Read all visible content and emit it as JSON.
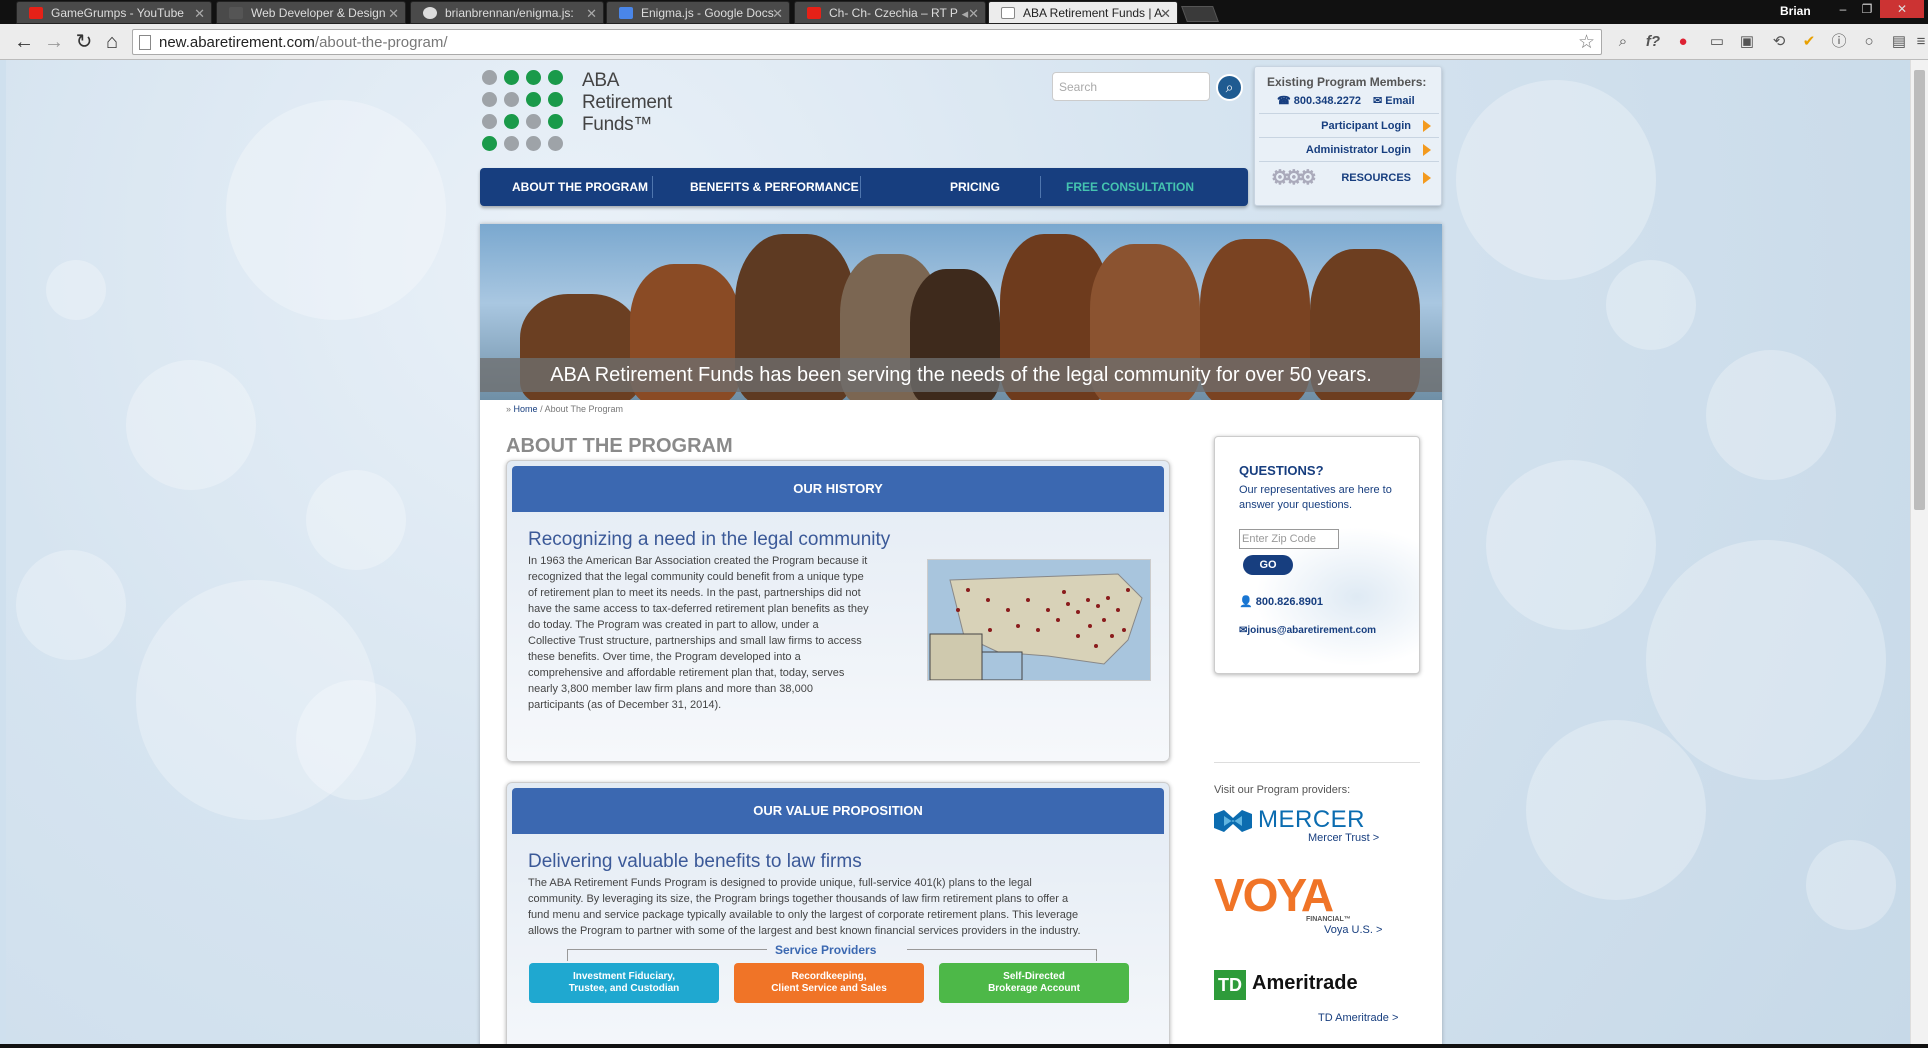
{
  "browser": {
    "tabs": [
      {
        "title": "GameGrumps - YouTube",
        "icon": "youtube-icon",
        "color": "#e62117"
      },
      {
        "title": "Web Developer & Design",
        "icon": "page-icon",
        "color": "#555555"
      },
      {
        "title": "brianbrennan/enigma.js:",
        "icon": "github-icon",
        "color": "#dddddd"
      },
      {
        "title": "Enigma.js - Google Docs",
        "icon": "docs-icon",
        "color": "#4a86e8"
      },
      {
        "title": "Ch- Ch- Czechia – RT P",
        "icon": "youtube-icon",
        "color": "#e62117"
      },
      {
        "title": "ABA Retirement Funds | A",
        "icon": "page-icon",
        "color": "#555555"
      }
    ],
    "user": "Brian",
    "url_domain": "new.abaretirement.com",
    "url_path": "/about-the-program/"
  },
  "site": {
    "logo_line1": "ABA",
    "logo_line2": "Retirement",
    "logo_line3": "Funds™",
    "search_placeholder": "Search",
    "nav": [
      "ABOUT THE PROGRAM",
      "BENEFITS & PERFORMANCE",
      "PRICING",
      "FREE CONSULTATION"
    ],
    "members": {
      "heading": "Existing Program Members:",
      "phone": "800.348.2272",
      "email": "Email",
      "participant_login": "Participant Login",
      "administrator_login": "Administrator Login",
      "resources": "RESOURCES"
    },
    "hero_caption": "ABA Retirement Funds has been serving the needs of the legal community for over 50 years.",
    "breadcrumb": {
      "prefix": "»",
      "home": "Home",
      "sep": "/",
      "current": "About The Program"
    },
    "page_title": "ABOUT THE PROGRAM",
    "history": {
      "header": "OUR HISTORY",
      "heading": "Recognizing a need in the legal community",
      "lines": [
        "In 1963 the American Bar Association created the Program because it",
        "recognized that the legal community could benefit from a unique type",
        "of retirement plan to meet its needs. In the past, partnerships did not",
        "have the same access to tax-deferred retirement plan benefits as they",
        "do today. The Program was created in part to allow, under a",
        "Collective Trust structure, partnerships and small law firms to access",
        "these benefits. Over time, the Program developed into a",
        "comprehensive and affordable retirement plan that, today, serves",
        "nearly 3,800 member law firm plans and more than 38,000",
        "participants (as of December 31, 2014)."
      ]
    },
    "value": {
      "header": "OUR VALUE PROPOSITION",
      "heading": "Delivering valuable benefits to law firms",
      "lines": [
        "The ABA Retirement Funds Program is designed to provide unique, full-service 401(k) plans to the legal",
        "community. By leveraging its size, the Program brings together thousands of law firm retirement plans to offer a",
        "fund menu and service package typically available to only the largest of corporate retirement plans. This leverage",
        "allows the Program to partner with some of the largest and best known financial services providers in the industry."
      ],
      "service_providers_title": "Service Providers",
      "providers": [
        {
          "line1": "Investment Fiduciary,",
          "line2": "Trustee, and Custodian",
          "color": "#1fa8d0"
        },
        {
          "line1": "Recordkeeping,",
          "line2": "Client Service and Sales",
          "color": "#f07427"
        },
        {
          "line1": "Self-Directed",
          "line2": "Brokerage Account",
          "color": "#4db848"
        }
      ]
    },
    "questions": {
      "title": "QUESTIONS?",
      "text": "Our representatives are here to answer your questions.",
      "zip_placeholder": "Enter Zip Code",
      "go": "GO",
      "phone": "800.826.8901",
      "email": "joinus@abaretirement.com"
    },
    "visit_text": "Visit our Program providers:",
    "mercer": {
      "logo": "MERCER",
      "link": "Mercer Trust >"
    },
    "voya": {
      "logo": "VOYA",
      "sub": "FINANCIAL™",
      "link": "Voya U.S. >"
    },
    "td": {
      "logo_mark": "TD",
      "logo": "Ameritrade",
      "link": "TD Ameritrade >"
    },
    "colors": {
      "navy": "#173e7f",
      "card_header": "#3b68b1",
      "free_consult": "#45c4b0",
      "arrow": "#f39a1e",
      "green_dot": "#1a9a4a",
      "gray_dot": "#9ea3a8"
    }
  }
}
